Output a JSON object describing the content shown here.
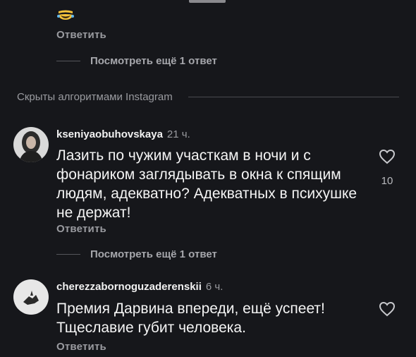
{
  "top_comment": {
    "reply_label": "Ответить"
  },
  "thread1": {
    "more_replies_label": "Посмотреть ещё 1 ответ"
  },
  "hidden_section": {
    "label": "Скрыты алгоритмами Instagram"
  },
  "comments": [
    {
      "username": "kseniyaobuhovskaya",
      "time": "21 ч.",
      "text": "Лазить по чужим участкам в ночи и с фонариком заглядывать в окна к спящим людям, адекватно? Адекватных в психушке не держат!",
      "reply_label": "Ответить",
      "likes": "10",
      "more_replies_label": "Посмотреть ещё 1 ответ"
    },
    {
      "username": "cherezzabornoguzaderenskii",
      "time": "6 ч.",
      "text": "Премия Дарвина впереди, ещё успеет! Тщеславие губит человека.",
      "reply_label": "Ответить"
    }
  ],
  "icons": {
    "like": "heart-outline-icon",
    "emoji": "laughing-tears-emoji"
  },
  "colors": {
    "background": "#16171b",
    "secondary_text": "#9a9ba0",
    "primary_text": "#f2f2f2"
  }
}
